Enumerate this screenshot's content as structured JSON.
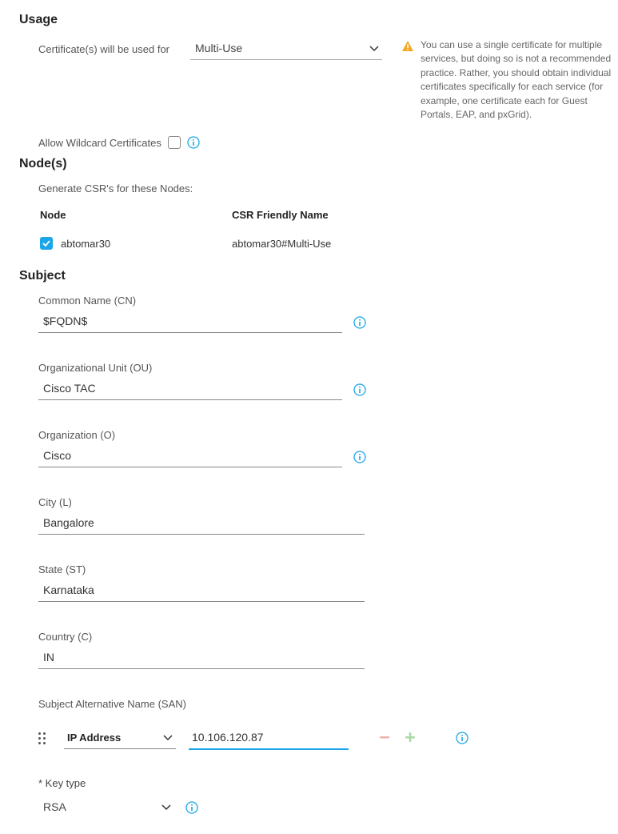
{
  "usage": {
    "heading": "Usage",
    "cert_used_label": "Certificate(s) will be used for",
    "selected_usage": "Multi-Use",
    "note": "You can use a single certificate for multiple services, but doing so is not a recommended practice. Rather, you should obtain individual certificates specifically for each service (for example, one certificate each for Guest Portals, EAP, and pxGrid).",
    "wildcard_label": "Allow Wildcard Certificates"
  },
  "nodes": {
    "heading": "Node(s)",
    "desc": "Generate CSR's for these Nodes:",
    "col_node": "Node",
    "col_csr": "CSR Friendly Name",
    "row_node": "abtomar30",
    "row_csr": "abtomar30#Multi-Use"
  },
  "subject": {
    "heading": "Subject",
    "cn_label": "Common Name (CN)",
    "cn_value": "$FQDN$",
    "ou_label": "Organizational Unit (OU)",
    "ou_value": "Cisco TAC",
    "o_label": "Organization (O)",
    "o_value": "Cisco",
    "l_label": "City (L)",
    "l_value": "Bangalore",
    "st_label": "State (ST)",
    "st_value": "Karnataka",
    "c_label": "Country (C)",
    "c_value": "IN"
  },
  "san": {
    "label": "Subject Alternative Name (SAN)",
    "type_selected": "IP Address",
    "ip_value": "10.106.120.87"
  },
  "keytype": {
    "label": "* Key type",
    "selected": "RSA"
  }
}
